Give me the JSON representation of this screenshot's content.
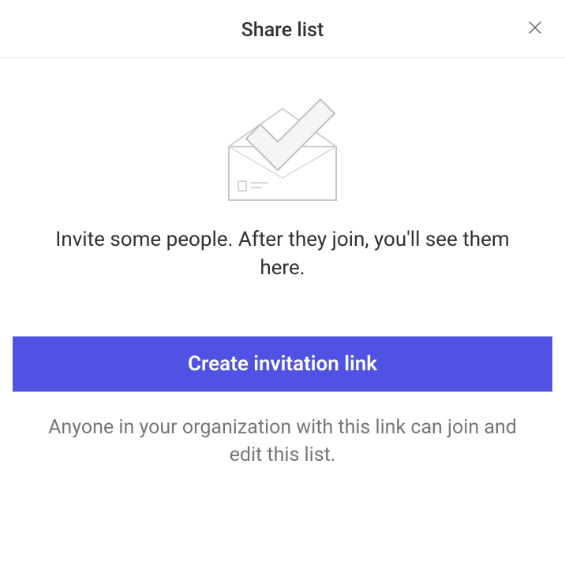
{
  "dialog": {
    "title": "Share list",
    "invite_message": "Invite some people. After they join, you'll see them here.",
    "create_button_label": "Create invitation link",
    "footer_message": "Anyone in your organization with this link can join and edit this list."
  }
}
